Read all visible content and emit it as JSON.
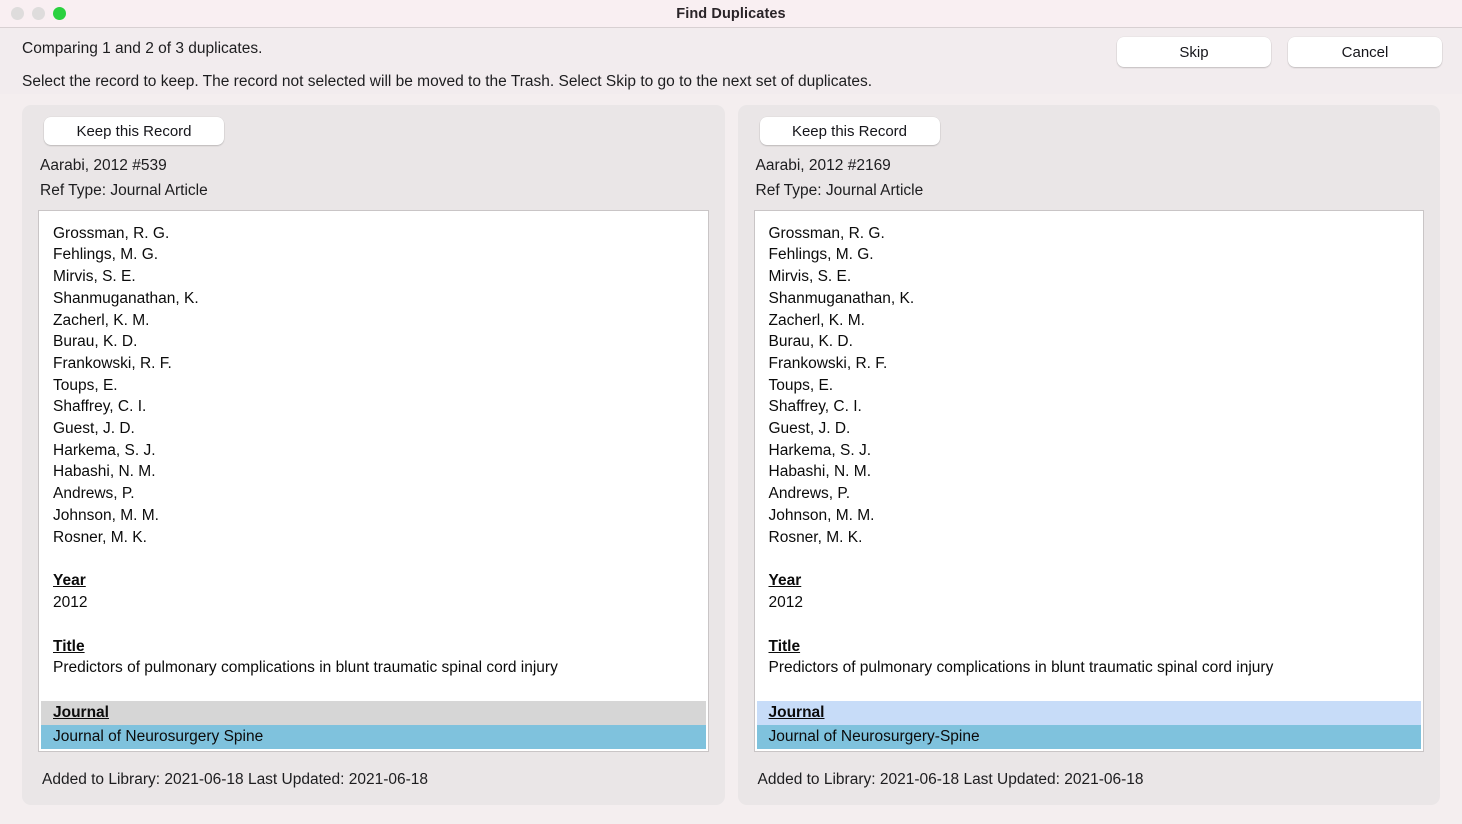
{
  "window": {
    "title": "Find Duplicates",
    "traffic_lights": [
      "close-button",
      "minimize-button",
      "zoom-button"
    ]
  },
  "topbar": {
    "comparing_text": "Comparing 1 and 2 of 3 duplicates.",
    "instruction_text": "Select the record to keep. The record not selected will be moved to the Trash. Select Skip to go to the next set of duplicates.",
    "skip_label": "Skip",
    "cancel_label": "Cancel"
  },
  "colors": {
    "window_background": "#f4eeef",
    "titlebar_background": "#f9eff2",
    "panel_background": "#eae6e7",
    "record_background": "#ffffff",
    "highlight_blue": "#7fc2dd",
    "highlight_gray": "#d6d6d6",
    "highlight_light_blue": "#c7dcf8",
    "zoom_button_green": "#2ad13f"
  },
  "left_panel": {
    "keep_label": "Keep this Record",
    "record_id": "Aarabi, 2012 #539",
    "ref_type_label": "Ref Type:",
    "ref_type_value": "Journal Article",
    "ref_type_line": "Ref Type:  Journal Article",
    "authors": [
      "Grossman, R. G.",
      "Fehlings, M. G.",
      "Mirvis, S. E.",
      "Shanmuganathan, K.",
      "Zacherl, K. M.",
      "Burau, K. D.",
      "Frankowski, R. F.",
      "Toups, E.",
      "Shaffrey, C. I.",
      "Guest, J. D.",
      "Harkema, S. J.",
      "Habashi, N. M.",
      "Andrews, P.",
      "Johnson, M. M.",
      "Rosner, M. K."
    ],
    "year_label": "Year",
    "year_value": "2012",
    "title_label": "Title",
    "title_value": "Predictors of pulmonary complications in blunt traumatic spinal cord injury",
    "journal_label": "Journal",
    "journal_value": "Journal of Neurosurgery Spine",
    "journal_label_highlight": "#d6d6d6",
    "journal_value_highlight": "#7fc2dd",
    "footer": "Added to Library: 2021-06-18    Last Updated: 2021-06-18"
  },
  "right_panel": {
    "keep_label": "Keep this Record",
    "record_id": "Aarabi, 2012 #2169",
    "ref_type_label": "Ref Type:",
    "ref_type_value": "Journal Article",
    "ref_type_line": "Ref Type:  Journal Article",
    "authors": [
      "Grossman, R. G.",
      "Fehlings, M. G.",
      "Mirvis, S. E.",
      "Shanmuganathan, K.",
      "Zacherl, K. M.",
      "Burau, K. D.",
      "Frankowski, R. F.",
      "Toups, E.",
      "Shaffrey, C. I.",
      "Guest, J. D.",
      "Harkema, S. J.",
      "Habashi, N. M.",
      "Andrews, P.",
      "Johnson, M. M.",
      "Rosner, M. K."
    ],
    "year_label": "Year",
    "year_value": "2012",
    "title_label": "Title",
    "title_value": "Predictors of pulmonary complications in blunt traumatic spinal cord injury",
    "journal_label": "Journal",
    "journal_value": "Journal of Neurosurgery-Spine",
    "journal_label_highlight": "#c7dcf8",
    "journal_value_highlight": "#7fc2dd",
    "footer": "Added to Library: 2021-06-18    Last Updated: 2021-06-18"
  }
}
